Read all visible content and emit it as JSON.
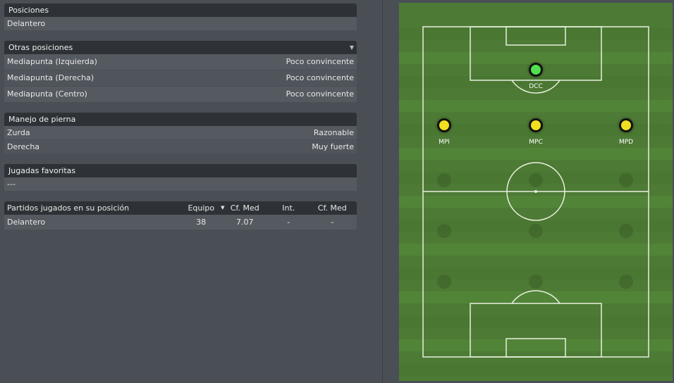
{
  "positions": {
    "header": "Posiciones",
    "value": "Delantero"
  },
  "other_positions": {
    "header": "Otras posiciones",
    "items": [
      {
        "name": "Mediapunta (Izquierda)",
        "rating": "Poco convincente"
      },
      {
        "name": "Mediapunta (Derecha)",
        "rating": "Poco convincente"
      },
      {
        "name": "Mediapunta (Centro)",
        "rating": "Poco convincente"
      }
    ]
  },
  "footedness": {
    "header": "Manejo de pierna",
    "items": [
      {
        "name": "Zurda",
        "rating": "Razonable"
      },
      {
        "name": "Derecha",
        "rating": "Muy fuerte"
      }
    ]
  },
  "favorite_plays": {
    "header": "Jugadas favoritas",
    "value": "---"
  },
  "matches_table": {
    "headers": [
      "Partidos jugados en su posición",
      "Equipo",
      "Cf. Med",
      "Int.",
      "Cf. Med"
    ],
    "rows": [
      [
        "Delantero",
        "38",
        "7.07",
        "-",
        "-"
      ]
    ]
  },
  "pitch": {
    "markers": [
      {
        "label": "DCC",
        "color": "#4ee04e",
        "highlight": true
      },
      {
        "label": "MPI",
        "color": "#f0e020",
        "highlight": false
      },
      {
        "label": "MPC",
        "color": "#f0e020",
        "highlight": false
      },
      {
        "label": "MPD",
        "color": "#f0e020",
        "highlight": false
      }
    ]
  }
}
